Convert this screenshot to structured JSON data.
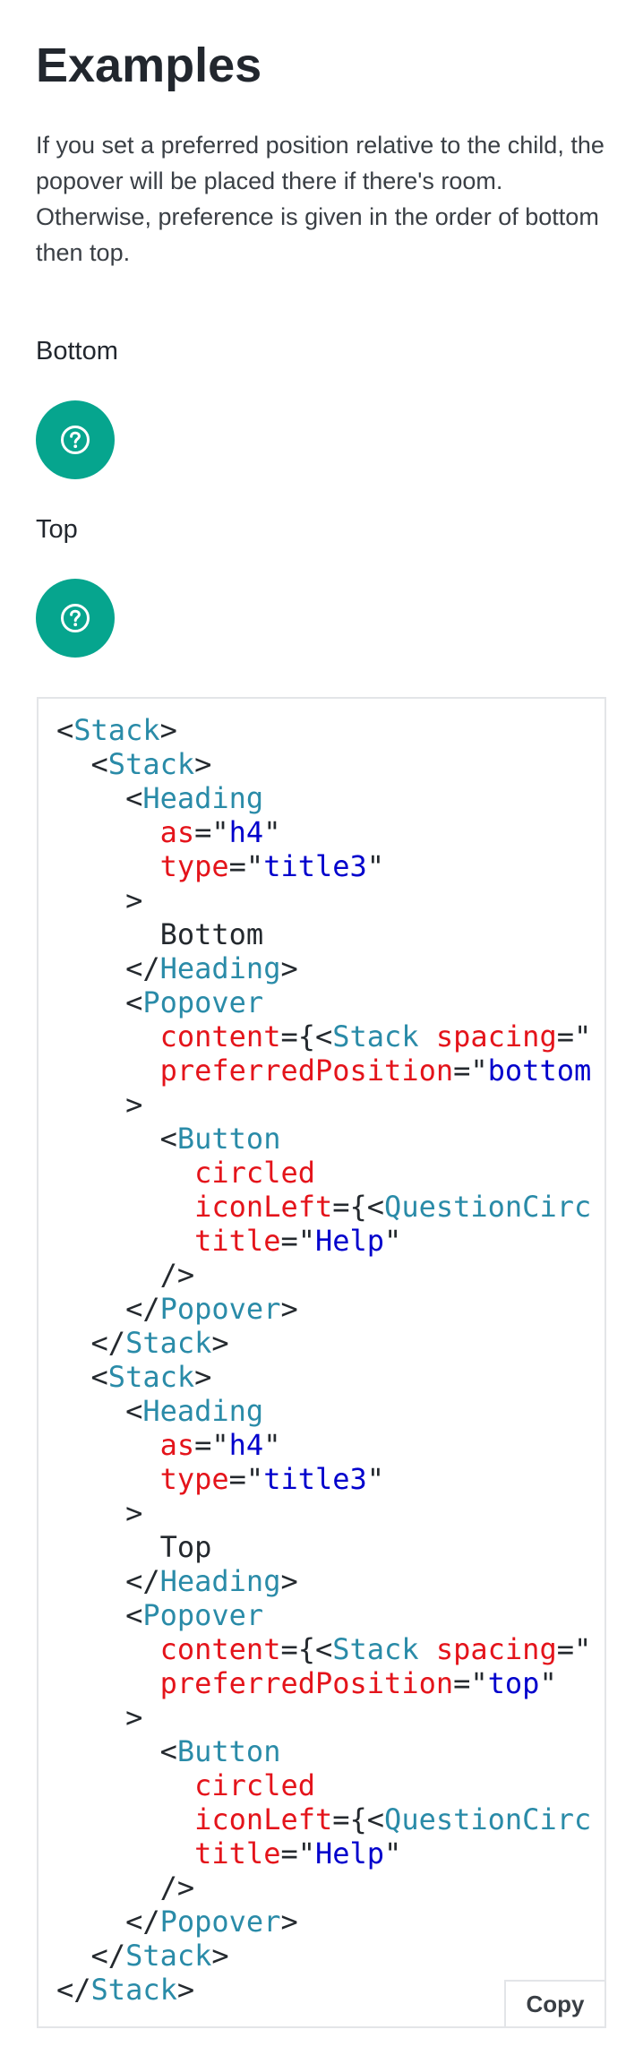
{
  "page": {
    "title": "Examples",
    "intro": "If you set a preferred position relative to the child, the popover will be placed there if there's room. Otherwise, preference is given in the order of bottom then top."
  },
  "examples": [
    {
      "heading": "Bottom",
      "button_icon": "question-circle-icon",
      "button_color": "#06a58e"
    },
    {
      "heading": "Top",
      "button_icon": "question-circle-icon",
      "button_color": "#06a58e"
    }
  ],
  "code": {
    "copy_label": "Copy",
    "lines": [
      [
        [
          "p",
          "<"
        ],
        [
          "tag",
          "Stack"
        ],
        [
          "p",
          ">"
        ]
      ],
      [
        [
          "p",
          "  <"
        ],
        [
          "tag",
          "Stack"
        ],
        [
          "p",
          ">"
        ]
      ],
      [
        [
          "p",
          "    <"
        ],
        [
          "tag",
          "Heading"
        ]
      ],
      [
        [
          "p",
          "      "
        ],
        [
          "attr",
          "as"
        ],
        [
          "p",
          "=\""
        ],
        [
          "str",
          "h4"
        ],
        [
          "p",
          "\""
        ]
      ],
      [
        [
          "p",
          "      "
        ],
        [
          "attr",
          "type"
        ],
        [
          "p",
          "=\""
        ],
        [
          "str",
          "title3"
        ],
        [
          "p",
          "\""
        ]
      ],
      [
        [
          "p",
          "    >"
        ]
      ],
      [
        [
          "p",
          "      Bottom"
        ]
      ],
      [
        [
          "p",
          "    </"
        ],
        [
          "tag",
          "Heading"
        ],
        [
          "p",
          ">"
        ]
      ],
      [
        [
          "p",
          "    <"
        ],
        [
          "tag",
          "Popover"
        ]
      ],
      [
        [
          "p",
          "      "
        ],
        [
          "attr",
          "content"
        ],
        [
          "p",
          "={<"
        ],
        [
          "tag",
          "Stack"
        ],
        [
          "p",
          " "
        ],
        [
          "attr",
          "spacing"
        ],
        [
          "p",
          "=\""
        ]
      ],
      [
        [
          "p",
          "      "
        ],
        [
          "attr",
          "preferredPosition"
        ],
        [
          "p",
          "=\""
        ],
        [
          "str",
          "bottom"
        ]
      ],
      [
        [
          "p",
          "    >"
        ]
      ],
      [
        [
          "p",
          "      <"
        ],
        [
          "tag",
          "Button"
        ]
      ],
      [
        [
          "p",
          "        "
        ],
        [
          "attr",
          "circled"
        ]
      ],
      [
        [
          "p",
          "        "
        ],
        [
          "attr",
          "iconLeft"
        ],
        [
          "p",
          "={<"
        ],
        [
          "tag",
          "QuestionCirc"
        ]
      ],
      [
        [
          "p",
          "        "
        ],
        [
          "attr",
          "title"
        ],
        [
          "p",
          "=\""
        ],
        [
          "str",
          "Help"
        ],
        [
          "p",
          "\""
        ]
      ],
      [
        [
          "p",
          "      />"
        ]
      ],
      [
        [
          "p",
          "    </"
        ],
        [
          "tag",
          "Popover"
        ],
        [
          "p",
          ">"
        ]
      ],
      [
        [
          "p",
          "  </"
        ],
        [
          "tag",
          "Stack"
        ],
        [
          "p",
          ">"
        ]
      ],
      [
        [
          "p",
          "  <"
        ],
        [
          "tag",
          "Stack"
        ],
        [
          "p",
          ">"
        ]
      ],
      [
        [
          "p",
          "    <"
        ],
        [
          "tag",
          "Heading"
        ]
      ],
      [
        [
          "p",
          "      "
        ],
        [
          "attr",
          "as"
        ],
        [
          "p",
          "=\""
        ],
        [
          "str",
          "h4"
        ],
        [
          "p",
          "\""
        ]
      ],
      [
        [
          "p",
          "      "
        ],
        [
          "attr",
          "type"
        ],
        [
          "p",
          "=\""
        ],
        [
          "str",
          "title3"
        ],
        [
          "p",
          "\""
        ]
      ],
      [
        [
          "p",
          "    >"
        ]
      ],
      [
        [
          "p",
          "      Top"
        ]
      ],
      [
        [
          "p",
          "    </"
        ],
        [
          "tag",
          "Heading"
        ],
        [
          "p",
          ">"
        ]
      ],
      [
        [
          "p",
          "    <"
        ],
        [
          "tag",
          "Popover"
        ]
      ],
      [
        [
          "p",
          "      "
        ],
        [
          "attr",
          "content"
        ],
        [
          "p",
          "={<"
        ],
        [
          "tag",
          "Stack"
        ],
        [
          "p",
          " "
        ],
        [
          "attr",
          "spacing"
        ],
        [
          "p",
          "=\""
        ]
      ],
      [
        [
          "p",
          "      "
        ],
        [
          "attr",
          "preferredPosition"
        ],
        [
          "p",
          "=\""
        ],
        [
          "str",
          "top"
        ],
        [
          "p",
          "\""
        ]
      ],
      [
        [
          "p",
          "    >"
        ]
      ],
      [
        [
          "p",
          "      <"
        ],
        [
          "tag",
          "Button"
        ]
      ],
      [
        [
          "p",
          "        "
        ],
        [
          "attr",
          "circled"
        ]
      ],
      [
        [
          "p",
          "        "
        ],
        [
          "attr",
          "iconLeft"
        ],
        [
          "p",
          "={<"
        ],
        [
          "tag",
          "QuestionCirc"
        ]
      ],
      [
        [
          "p",
          "        "
        ],
        [
          "attr",
          "title"
        ],
        [
          "p",
          "=\""
        ],
        [
          "str",
          "Help"
        ],
        [
          "p",
          "\""
        ]
      ],
      [
        [
          "p",
          "      />"
        ]
      ],
      [
        [
          "p",
          "    </"
        ],
        [
          "tag",
          "Popover"
        ],
        [
          "p",
          ">"
        ]
      ],
      [
        [
          "p",
          "  </"
        ],
        [
          "tag",
          "Stack"
        ],
        [
          "p",
          ">"
        ]
      ],
      [
        [
          "p",
          "</"
        ],
        [
          "tag",
          "Stack"
        ],
        [
          "p",
          ">"
        ]
      ]
    ]
  },
  "colors": {
    "accent": "#06a58e",
    "code_tag": "#2a8ba8",
    "code_attr": "#e4141b",
    "code_string": "#0000cc"
  }
}
